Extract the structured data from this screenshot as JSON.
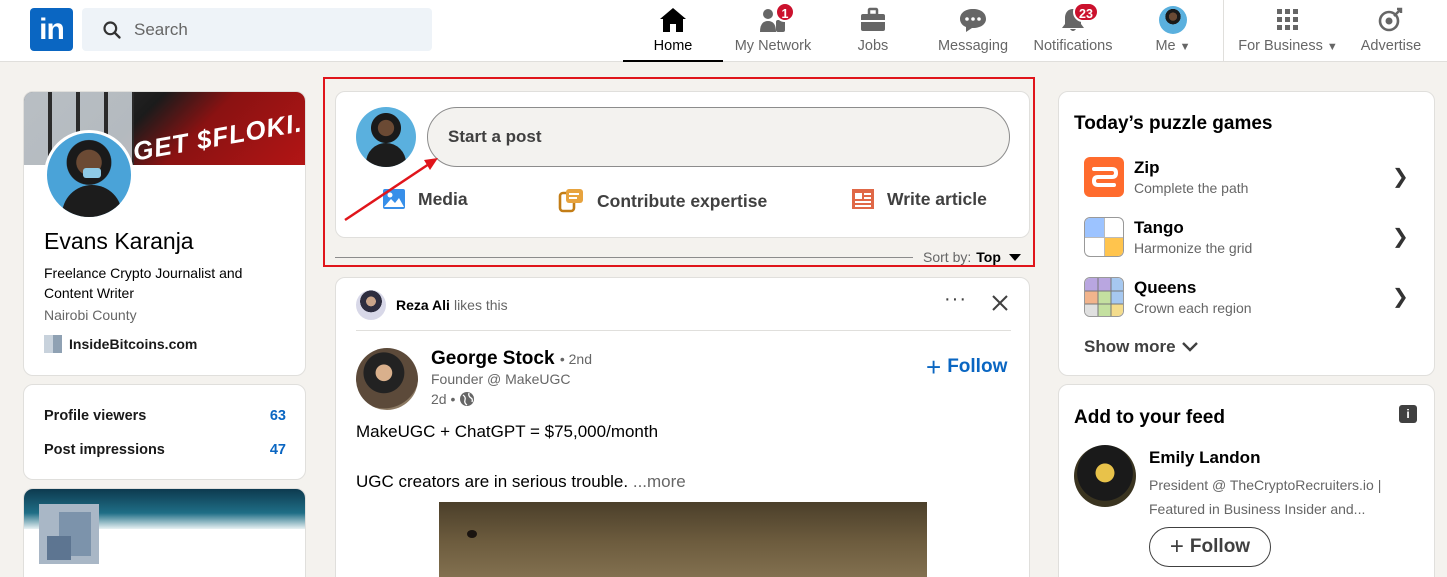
{
  "nav": {
    "logo": "in",
    "search_placeholder": "Search",
    "items": [
      {
        "label": "Home",
        "badge": ""
      },
      {
        "label": "My Network",
        "badge": "1"
      },
      {
        "label": "Jobs",
        "badge": ""
      },
      {
        "label": "Messaging",
        "badge": ""
      },
      {
        "label": "Notifications",
        "badge": "23"
      },
      {
        "label": "Me",
        "badge": ""
      },
      {
        "label": "For Business",
        "badge": ""
      },
      {
        "label": "Advertise",
        "badge": ""
      }
    ]
  },
  "profile": {
    "banner_text": "GET $FLOKI.",
    "name": "Evans Karanja",
    "headline": "Freelance Crypto Journalist and Content Writer",
    "location": "Nairobi County",
    "company": "InsideBitcoins.com"
  },
  "stats": [
    {
      "label": "Profile viewers",
      "value": "63"
    },
    {
      "label": "Post impressions",
      "value": "47"
    }
  ],
  "composer": {
    "placeholder": "Start a post",
    "actions": [
      "Media",
      "Contribute expertise",
      "Write article"
    ]
  },
  "sort": {
    "label": "Sort by:",
    "value": "Top"
  },
  "post": {
    "social_actor": "Reza Ali",
    "social_action": "likes this",
    "author": "George Stock",
    "degree": "• 2nd",
    "author_title": "Founder @ MakeUGC",
    "time": "2d •",
    "follow": "Follow",
    "text1": "MakeUGC + ChatGPT = $75,000/month",
    "text2": "UGC creators are in serious trouble.",
    "more": "...more"
  },
  "puzzles": {
    "title": "Today’s puzzle games",
    "games": [
      {
        "name": "Zip",
        "sub": "Complete the path"
      },
      {
        "name": "Tango",
        "sub": "Harmonize the grid"
      },
      {
        "name": "Queens",
        "sub": "Crown each region"
      }
    ],
    "show_more": "Show more"
  },
  "feed": {
    "title": "Add to your feed",
    "name": "Emily Landon",
    "desc_line1": "President @ TheCryptoRecruiters.io |",
    "desc_line2": "Featured in Business Insider and...",
    "follow": "Follow"
  },
  "colors": {
    "brand": "#0a66c2",
    "badge": "#cb112d",
    "highlight": "#e0151b"
  }
}
